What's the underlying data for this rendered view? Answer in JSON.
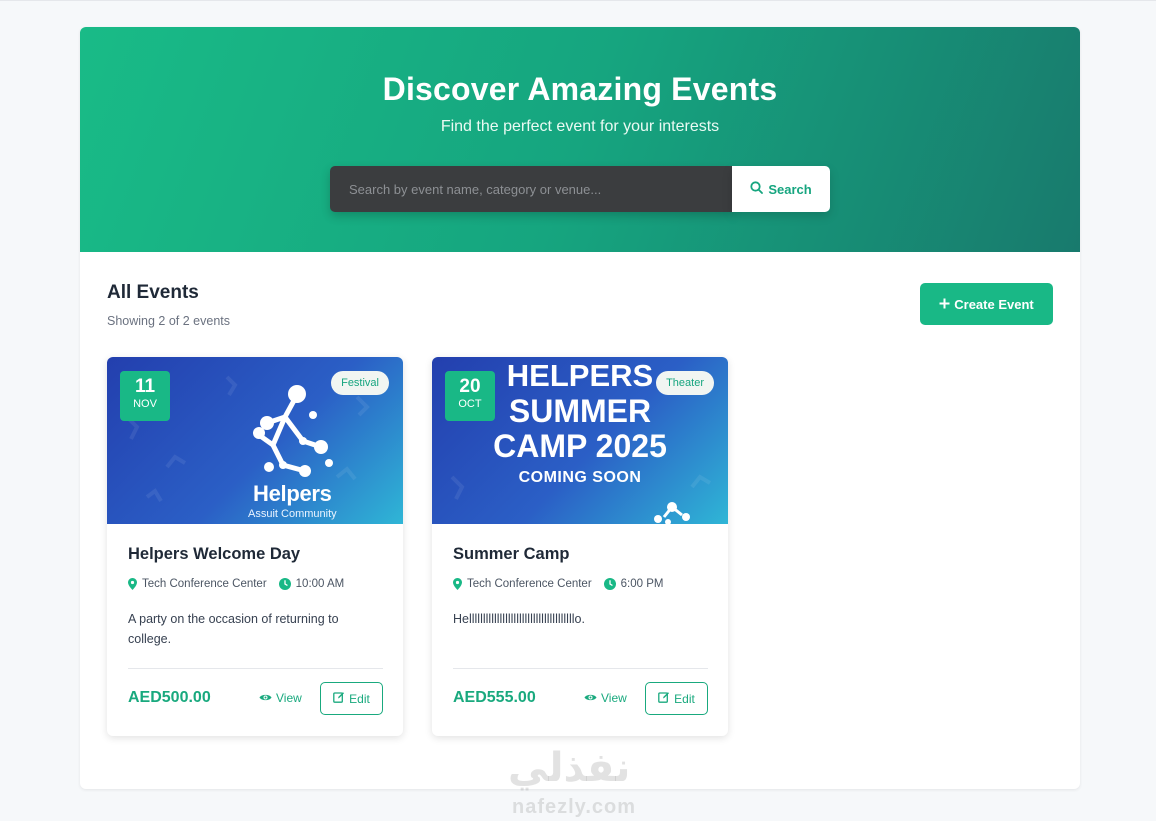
{
  "hero": {
    "title": "Discover Amazing Events",
    "subtitle": "Find the perfect event for your interests",
    "search_placeholder": "Search by event name, category or venue...",
    "search_button": "Search"
  },
  "events_section": {
    "title": "All Events",
    "count_text": "Showing 2 of 2 events",
    "create_button": "Create Event"
  },
  "events": [
    {
      "day": "11",
      "month": "NOV",
      "category": "Festival",
      "poster_title": "Helpers",
      "poster_subtitle": "Assuit Community",
      "title": "Helpers Welcome Day",
      "venue": "Tech Conference Center",
      "time": "10:00 AM",
      "description": "A party on the occasion of returning to college.",
      "price": "AED500.00",
      "view_label": "View",
      "edit_label": "Edit"
    },
    {
      "day": "20",
      "month": "OCT",
      "category": "Theater",
      "poster_lines": [
        "HELPERS",
        "SUMMER",
        "CAMP 2025",
        "COMING SOON"
      ],
      "title": "Summer Camp",
      "venue": "Tech Conference Center",
      "time": "6:00 PM",
      "description": "Hellllllllllllllllllllllllllllllllllllllo.",
      "price": "AED555.00",
      "view_label": "View",
      "edit_label": "Edit"
    }
  ],
  "watermark": {
    "arabic": "نفذلي",
    "latin": "nafezly.com"
  },
  "colors": {
    "primary": "#19b886",
    "primary_dark": "#187a6d",
    "poster_blue": "#2b5fc6"
  }
}
